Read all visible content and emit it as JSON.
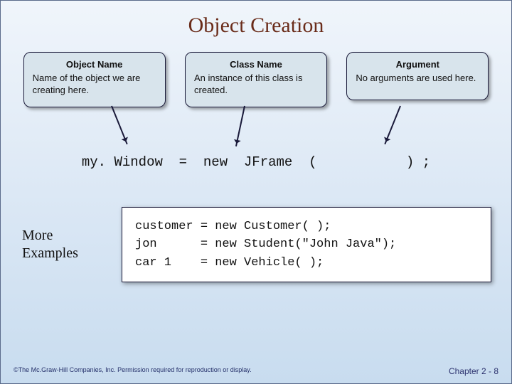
{
  "title": "Object Creation",
  "callouts": [
    {
      "heading": "Object Name",
      "body": "Name of the object we are creating here."
    },
    {
      "heading": "Class Name",
      "body": "An instance of this class is created."
    },
    {
      "heading": "Argument",
      "body": "No arguments are used here."
    }
  ],
  "codeline": "my. Window  =  new  JFrame  (           ) ;",
  "more_label": "More\nExamples",
  "examples": "customer = new Customer( );\njon      = new Student(\"John Java\");\ncar 1    = new Vehicle( );",
  "footer": {
    "copyright": "©The Mc.Graw-Hill Companies, Inc. Permission required for reproduction or display.",
    "page": "Chapter 2 - 8"
  }
}
